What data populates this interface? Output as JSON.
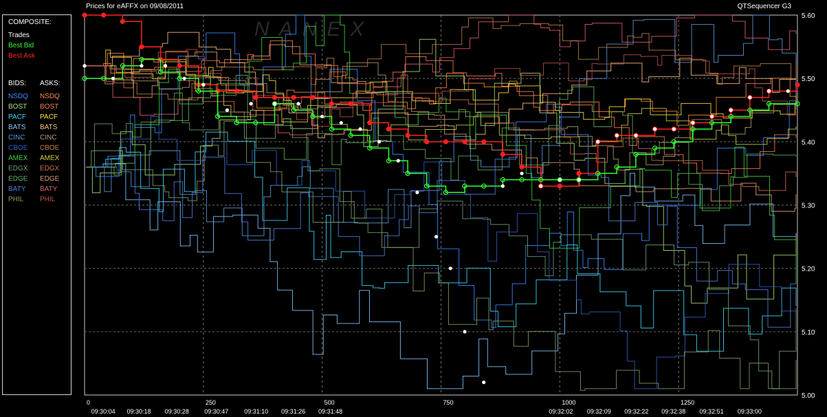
{
  "header": {
    "title": "Prices for  eAFFX  on  09/08/2011",
    "app": "QTSequencer G3",
    "watermark": "NANEX"
  },
  "legend": {
    "composite_title": "COMPOSITE:",
    "composite": [
      {
        "label": "Trades",
        "color": "#ffffff"
      },
      {
        "label": "Best Bid",
        "color": "#33ff33"
      },
      {
        "label": "Best Ask",
        "color": "#ff2020"
      }
    ],
    "bids_title": "BIDS:",
    "asks_title": "ASKS:",
    "exchanges": [
      {
        "bid": "NSDQ",
        "ask": "NSDQ",
        "bid_color": "#3b8cff",
        "ask_color": "#ff8c3b"
      },
      {
        "bid": "BOST",
        "ask": "BOST",
        "bid_color": "#a8e07a",
        "ask_color": "#ff7a50"
      },
      {
        "bid": "PACF",
        "ask": "PACF",
        "bid_color": "#40d8ff",
        "ask_color": "#ffe040"
      },
      {
        "bid": "BATS",
        "ask": "BATS",
        "bid_color": "#80c8ff",
        "ask_color": "#ffc080"
      },
      {
        "bid": "CINC",
        "ask": "CINC",
        "bid_color": "#5a9ad8",
        "ask_color": "#b0a070"
      },
      {
        "bid": "CBOE",
        "ask": "CBOE",
        "bid_color": "#3060c0",
        "ask_color": "#c08040"
      },
      {
        "bid": "AMEX",
        "ask": "AMEX",
        "bid_color": "#40d040",
        "ask_color": "#d0d040"
      },
      {
        "bid": "EDGX",
        "ask": "EDGX",
        "bid_color": "#70a070",
        "ask_color": "#d07050"
      },
      {
        "bid": "EDGE",
        "ask": "EDGE",
        "bid_color": "#60b060",
        "ask_color": "#e0a070"
      },
      {
        "bid": "BATY",
        "ask": "BATY",
        "bid_color": "#5080e0",
        "ask_color": "#e06070"
      },
      {
        "bid": "PHIL",
        "ask": "PHIL",
        "bid_color": "#80a060",
        "ask_color": "#c05050"
      }
    ]
  },
  "chart_data": {
    "type": "line",
    "title": "Prices for  eAFFX  on  09/08/2011",
    "ylim": [
      5.0,
      5.6
    ],
    "y_ticks": [
      "5.00",
      "5.10",
      "5.20",
      "5.30",
      "5.40",
      "5.50",
      "5.60"
    ],
    "xlim": [
      0,
      1500
    ],
    "x_seq_ticks": [
      {
        "seq": 0,
        "label": "0"
      },
      {
        "seq": 250,
        "label": "250"
      },
      {
        "seq": 500,
        "label": "500"
      },
      {
        "seq": 750,
        "label": "750"
      },
      {
        "seq": 1000,
        "label": "1000"
      },
      {
        "seq": 1250,
        "label": "1250"
      }
    ],
    "x_time_ticks": [
      {
        "seq": 40,
        "label": "09:30:04"
      },
      {
        "seq": 115,
        "label": "09:30:18"
      },
      {
        "seq": 195,
        "label": "09:30:28"
      },
      {
        "seq": 278,
        "label": "09:30:47"
      },
      {
        "seq": 362,
        "label": "09:31:10"
      },
      {
        "seq": 440,
        "label": "09:31:26"
      },
      {
        "seq": 518,
        "label": "09:31:48"
      },
      {
        "seq": 1003,
        "label": "09:32:02"
      },
      {
        "seq": 1083,
        "label": "09:32:09"
      },
      {
        "seq": 1162,
        "label": "09:32:22"
      },
      {
        "seq": 1240,
        "label": "09:32:38"
      },
      {
        "seq": 1320,
        "label": "09:32:51"
      },
      {
        "seq": 1400,
        "label": "09:33:00"
      }
    ],
    "grid": true,
    "series": [
      {
        "name": "Best Ask",
        "color": "#ff2020",
        "x": [
          0,
          40,
          80,
          120,
          160,
          200,
          240,
          280,
          320,
          360,
          400,
          440,
          480,
          520,
          560,
          600,
          640,
          680,
          720,
          760,
          800,
          840,
          880,
          920,
          960,
          1000,
          1040,
          1080,
          1120,
          1160,
          1200,
          1240,
          1280,
          1320,
          1360,
          1400,
          1440,
          1500
        ],
        "y": [
          5.6,
          5.6,
          5.59,
          5.55,
          5.53,
          5.52,
          5.49,
          5.48,
          5.48,
          5.47,
          5.47,
          5.47,
          5.47,
          5.46,
          5.46,
          5.43,
          5.42,
          5.41,
          5.4,
          5.4,
          5.4,
          5.4,
          5.38,
          5.36,
          5.33,
          5.33,
          5.35,
          5.4,
          5.41,
          5.41,
          5.42,
          5.42,
          5.43,
          5.44,
          5.45,
          5.47,
          5.48,
          5.49
        ]
      },
      {
        "name": "Best Bid",
        "color": "#33ff33",
        "x": [
          0,
          40,
          80,
          120,
          160,
          200,
          240,
          280,
          320,
          360,
          400,
          440,
          480,
          520,
          560,
          600,
          640,
          680,
          720,
          760,
          800,
          840,
          880,
          920,
          960,
          1000,
          1040,
          1080,
          1120,
          1160,
          1200,
          1240,
          1280,
          1320,
          1360,
          1400,
          1440,
          1500
        ],
        "y": [
          5.5,
          5.5,
          5.52,
          5.53,
          5.51,
          5.5,
          5.48,
          5.44,
          5.43,
          5.43,
          5.46,
          5.45,
          5.44,
          5.42,
          5.41,
          5.39,
          5.37,
          5.35,
          5.33,
          5.32,
          5.33,
          5.33,
          5.34,
          5.34,
          5.34,
          5.34,
          5.34,
          5.35,
          5.36,
          5.38,
          5.39,
          5.4,
          5.42,
          5.43,
          5.44,
          5.45,
          5.46,
          5.46
        ]
      },
      {
        "name": "Trades",
        "color": "#ffffff",
        "x": [
          0,
          60,
          120,
          170,
          210,
          250,
          300,
          350,
          400,
          450,
          500,
          540,
          580,
          620,
          660,
          700,
          740,
          770,
          800,
          840,
          880,
          920,
          960,
          1000,
          1040,
          1080,
          1120,
          1160,
          1200,
          1240,
          1280,
          1320,
          1360,
          1400,
          1440,
          1480
        ],
        "y": [
          5.52,
          5.5,
          5.52,
          5.52,
          5.5,
          5.49,
          5.45,
          5.46,
          5.46,
          5.46,
          5.44,
          5.43,
          5.42,
          5.4,
          5.37,
          5.32,
          5.25,
          5.2,
          5.1,
          5.02,
          5.33,
          5.35,
          5.33,
          5.34,
          5.34,
          5.4,
          5.41,
          5.41,
          5.42,
          5.42,
          5.43,
          5.44,
          5.45,
          5.47,
          5.48,
          5.48
        ]
      }
    ]
  }
}
